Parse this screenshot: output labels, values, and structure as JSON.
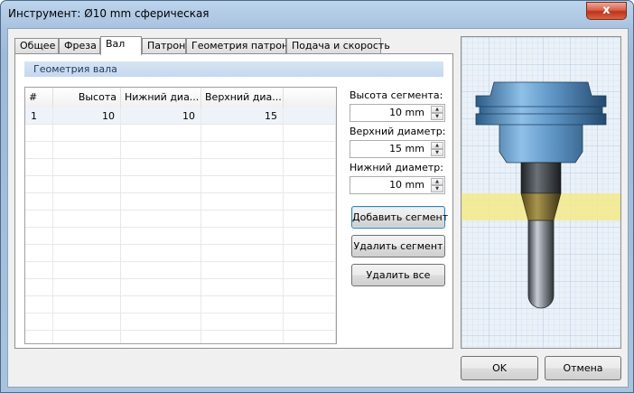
{
  "window": {
    "title": "Инструмент: Ø10 mm сферическая",
    "close_glyph": "x"
  },
  "tabs": [
    {
      "label": "Общее"
    },
    {
      "label": "Фреза"
    },
    {
      "label": "Вал",
      "active": true
    },
    {
      "label": "Патрон"
    },
    {
      "label": "Геометрия патрона"
    },
    {
      "label": "Подача и скорость"
    }
  ],
  "section": {
    "title": "Геометрия вала"
  },
  "grid": {
    "columns": [
      "#",
      "Высота",
      "Нижний диа...",
      "Верхний диа..."
    ],
    "rows": [
      {
        "index": "1",
        "height": "10",
        "lower": "10",
        "upper": "15"
      }
    ]
  },
  "fields": {
    "segment_height": {
      "label": "Высота сегмента:",
      "value": "10 mm"
    },
    "upper_diameter": {
      "label": "Верхний диаметр:",
      "value": "15 mm"
    },
    "lower_diameter": {
      "label": "Нижний диаметр:",
      "value": "10 mm"
    }
  },
  "buttons": {
    "add_segment": "Добавить сегмент",
    "delete_segment": "Удалить сегмент",
    "delete_all": "Удалить все",
    "ok": "OK",
    "cancel": "Отмена"
  },
  "preview": {
    "highlight_color": "#f3ea8a",
    "shaft_color": "#4a4f55",
    "holder_color": "#6aa0cf",
    "cutter_color": "#6e7379"
  }
}
